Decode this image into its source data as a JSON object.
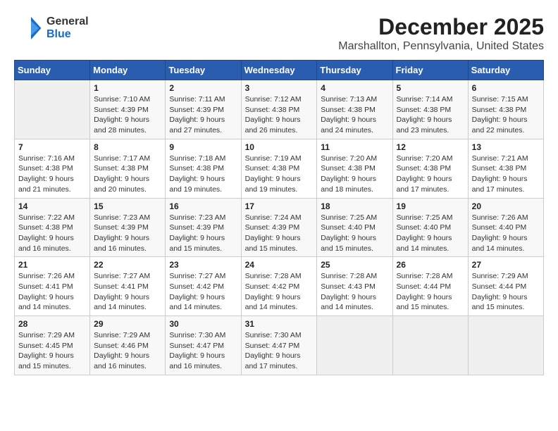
{
  "logo": {
    "general": "General",
    "blue": "Blue"
  },
  "title": "December 2025",
  "subtitle": "Marshallton, Pennsylvania, United States",
  "days_of_week": [
    "Sunday",
    "Monday",
    "Tuesday",
    "Wednesday",
    "Thursday",
    "Friday",
    "Saturday"
  ],
  "weeks": [
    [
      {
        "day": "",
        "info": ""
      },
      {
        "day": "1",
        "info": "Sunrise: 7:10 AM\nSunset: 4:39 PM\nDaylight: 9 hours\nand 28 minutes."
      },
      {
        "day": "2",
        "info": "Sunrise: 7:11 AM\nSunset: 4:39 PM\nDaylight: 9 hours\nand 27 minutes."
      },
      {
        "day": "3",
        "info": "Sunrise: 7:12 AM\nSunset: 4:38 PM\nDaylight: 9 hours\nand 26 minutes."
      },
      {
        "day": "4",
        "info": "Sunrise: 7:13 AM\nSunset: 4:38 PM\nDaylight: 9 hours\nand 24 minutes."
      },
      {
        "day": "5",
        "info": "Sunrise: 7:14 AM\nSunset: 4:38 PM\nDaylight: 9 hours\nand 23 minutes."
      },
      {
        "day": "6",
        "info": "Sunrise: 7:15 AM\nSunset: 4:38 PM\nDaylight: 9 hours\nand 22 minutes."
      }
    ],
    [
      {
        "day": "7",
        "info": "Sunrise: 7:16 AM\nSunset: 4:38 PM\nDaylight: 9 hours\nand 21 minutes."
      },
      {
        "day": "8",
        "info": "Sunrise: 7:17 AM\nSunset: 4:38 PM\nDaylight: 9 hours\nand 20 minutes."
      },
      {
        "day": "9",
        "info": "Sunrise: 7:18 AM\nSunset: 4:38 PM\nDaylight: 9 hours\nand 19 minutes."
      },
      {
        "day": "10",
        "info": "Sunrise: 7:19 AM\nSunset: 4:38 PM\nDaylight: 9 hours\nand 19 minutes."
      },
      {
        "day": "11",
        "info": "Sunrise: 7:20 AM\nSunset: 4:38 PM\nDaylight: 9 hours\nand 18 minutes."
      },
      {
        "day": "12",
        "info": "Sunrise: 7:20 AM\nSunset: 4:38 PM\nDaylight: 9 hours\nand 17 minutes."
      },
      {
        "day": "13",
        "info": "Sunrise: 7:21 AM\nSunset: 4:38 PM\nDaylight: 9 hours\nand 17 minutes."
      }
    ],
    [
      {
        "day": "14",
        "info": "Sunrise: 7:22 AM\nSunset: 4:38 PM\nDaylight: 9 hours\nand 16 minutes."
      },
      {
        "day": "15",
        "info": "Sunrise: 7:23 AM\nSunset: 4:39 PM\nDaylight: 9 hours\nand 16 minutes."
      },
      {
        "day": "16",
        "info": "Sunrise: 7:23 AM\nSunset: 4:39 PM\nDaylight: 9 hours\nand 15 minutes."
      },
      {
        "day": "17",
        "info": "Sunrise: 7:24 AM\nSunset: 4:39 PM\nDaylight: 9 hours\nand 15 minutes."
      },
      {
        "day": "18",
        "info": "Sunrise: 7:25 AM\nSunset: 4:40 PM\nDaylight: 9 hours\nand 15 minutes."
      },
      {
        "day": "19",
        "info": "Sunrise: 7:25 AM\nSunset: 4:40 PM\nDaylight: 9 hours\nand 14 minutes."
      },
      {
        "day": "20",
        "info": "Sunrise: 7:26 AM\nSunset: 4:40 PM\nDaylight: 9 hours\nand 14 minutes."
      }
    ],
    [
      {
        "day": "21",
        "info": "Sunrise: 7:26 AM\nSunset: 4:41 PM\nDaylight: 9 hours\nand 14 minutes."
      },
      {
        "day": "22",
        "info": "Sunrise: 7:27 AM\nSunset: 4:41 PM\nDaylight: 9 hours\nand 14 minutes."
      },
      {
        "day": "23",
        "info": "Sunrise: 7:27 AM\nSunset: 4:42 PM\nDaylight: 9 hours\nand 14 minutes."
      },
      {
        "day": "24",
        "info": "Sunrise: 7:28 AM\nSunset: 4:42 PM\nDaylight: 9 hours\nand 14 minutes."
      },
      {
        "day": "25",
        "info": "Sunrise: 7:28 AM\nSunset: 4:43 PM\nDaylight: 9 hours\nand 14 minutes."
      },
      {
        "day": "26",
        "info": "Sunrise: 7:28 AM\nSunset: 4:44 PM\nDaylight: 9 hours\nand 15 minutes."
      },
      {
        "day": "27",
        "info": "Sunrise: 7:29 AM\nSunset: 4:44 PM\nDaylight: 9 hours\nand 15 minutes."
      }
    ],
    [
      {
        "day": "28",
        "info": "Sunrise: 7:29 AM\nSunset: 4:45 PM\nDaylight: 9 hours\nand 15 minutes."
      },
      {
        "day": "29",
        "info": "Sunrise: 7:29 AM\nSunset: 4:46 PM\nDaylight: 9 hours\nand 16 minutes."
      },
      {
        "day": "30",
        "info": "Sunrise: 7:30 AM\nSunset: 4:47 PM\nDaylight: 9 hours\nand 16 minutes."
      },
      {
        "day": "31",
        "info": "Sunrise: 7:30 AM\nSunset: 4:47 PM\nDaylight: 9 hours\nand 17 minutes."
      },
      {
        "day": "",
        "info": ""
      },
      {
        "day": "",
        "info": ""
      },
      {
        "day": "",
        "info": ""
      }
    ]
  ]
}
